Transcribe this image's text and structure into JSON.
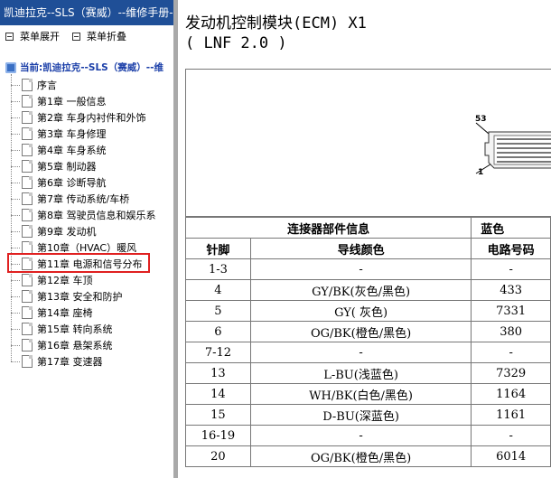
{
  "window": {
    "title": "凯迪拉克--SLS（赛威）--维修手册--"
  },
  "toolbar": {
    "expand_label": "菜单展开",
    "collapse_label": "菜单折叠"
  },
  "tree": {
    "root_label": "当前:凯迪拉克--SLS（赛威）--维",
    "items": [
      {
        "label": "序言"
      },
      {
        "label": "第1章 一般信息"
      },
      {
        "label": "第2章 车身内衬件和外饰"
      },
      {
        "label": "第3章 车身修理"
      },
      {
        "label": "第4章 车身系统"
      },
      {
        "label": "第5章 制动器"
      },
      {
        "label": "第6章 诊断导航"
      },
      {
        "label": "第7章 传动系统/车桥"
      },
      {
        "label": "第8章 驾驶员信息和娱乐系"
      },
      {
        "label": "第9章 发动机"
      },
      {
        "label": "第10章（HVAC）暖风"
      },
      {
        "label": "第11章 电源和信号分布"
      },
      {
        "label": "第12章 车顶"
      },
      {
        "label": "第13章 安全和防护"
      },
      {
        "label": "第14章 座椅"
      },
      {
        "label": "第15章 转向系统"
      },
      {
        "label": "第16章 悬架系统"
      },
      {
        "label": "第17章 变速器"
      }
    ],
    "selected_index": 11
  },
  "document": {
    "title_line1": "发动机控制模块(ECM) X1",
    "title_line2": "( LNF 2.0 )",
    "figure": {
      "pin_top": "53",
      "pin_bottom": "1"
    },
    "table": {
      "section_header": "连接器部件信息",
      "color_header": "蓝色",
      "col_pin": "针脚",
      "col_wire": "导线颜色",
      "col_circuit": "电路号码",
      "rows": [
        {
          "pin": "1-3",
          "wire": "-",
          "circuit": "-"
        },
        {
          "pin": "4",
          "wire": "GY/BK(灰色/黑色)",
          "circuit": "433"
        },
        {
          "pin": "5",
          "wire": "GY( 灰色)",
          "circuit": "7331"
        },
        {
          "pin": "6",
          "wire": "OG/BK(橙色/黑色)",
          "circuit": "380"
        },
        {
          "pin": "7-12",
          "wire": "-",
          "circuit": "-"
        },
        {
          "pin": "13",
          "wire": "L-BU(浅蓝色)",
          "circuit": "7329"
        },
        {
          "pin": "14",
          "wire": "WH/BK(白色/黑色)",
          "circuit": "1164"
        },
        {
          "pin": "15",
          "wire": "D-BU(深蓝色)",
          "circuit": "1161"
        },
        {
          "pin": "16-19",
          "wire": "-",
          "circuit": "-"
        },
        {
          "pin": "20",
          "wire": "OG/BK(橙色/黑色)",
          "circuit": "6014"
        }
      ]
    }
  },
  "colors": {
    "titlebar": "#1f4f97",
    "highlight": "#e02020",
    "splitter": "#a9a9a9"
  }
}
